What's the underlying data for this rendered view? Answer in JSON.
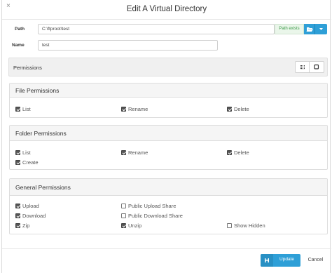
{
  "dialog": {
    "title": "Edit A Virtual Directory",
    "close_glyph": "×"
  },
  "form": {
    "path_label": "Path",
    "path_value": "C:\\ftproot\\test",
    "path_status": "Path exists",
    "name_label": "Name",
    "name_value": "test"
  },
  "permissions": {
    "header": "Permissions",
    "view_toggle_icons": [
      "grid-icon",
      "square-icon"
    ]
  },
  "file_permissions": {
    "title": "File Permissions",
    "items": [
      {
        "label": "List",
        "checked": true
      },
      {
        "label": "Rename",
        "checked": true
      },
      {
        "label": "Delete",
        "checked": true
      }
    ]
  },
  "folder_permissions": {
    "title": "Folder Permissions",
    "items": [
      {
        "label": "List",
        "checked": true
      },
      {
        "label": "Rename",
        "checked": true
      },
      {
        "label": "Delete",
        "checked": true
      },
      {
        "label": "Create",
        "checked": true
      }
    ]
  },
  "general_permissions": {
    "title": "General Permissions",
    "items": [
      {
        "label": "Upload",
        "checked": true
      },
      {
        "label": "Public Upload Share",
        "checked": false
      },
      {
        "label": "Download",
        "checked": true
      },
      {
        "label": "Public Download Share",
        "checked": false
      },
      {
        "label": "Zip",
        "checked": true
      },
      {
        "label": "Unzip",
        "checked": true
      },
      {
        "label": "Show Hidden",
        "checked": false
      }
    ]
  },
  "footer": {
    "update_label": "Update",
    "cancel_label": "Cancel"
  },
  "colors": {
    "primary": "#2e9fd7",
    "success_text": "#3c9a48"
  }
}
